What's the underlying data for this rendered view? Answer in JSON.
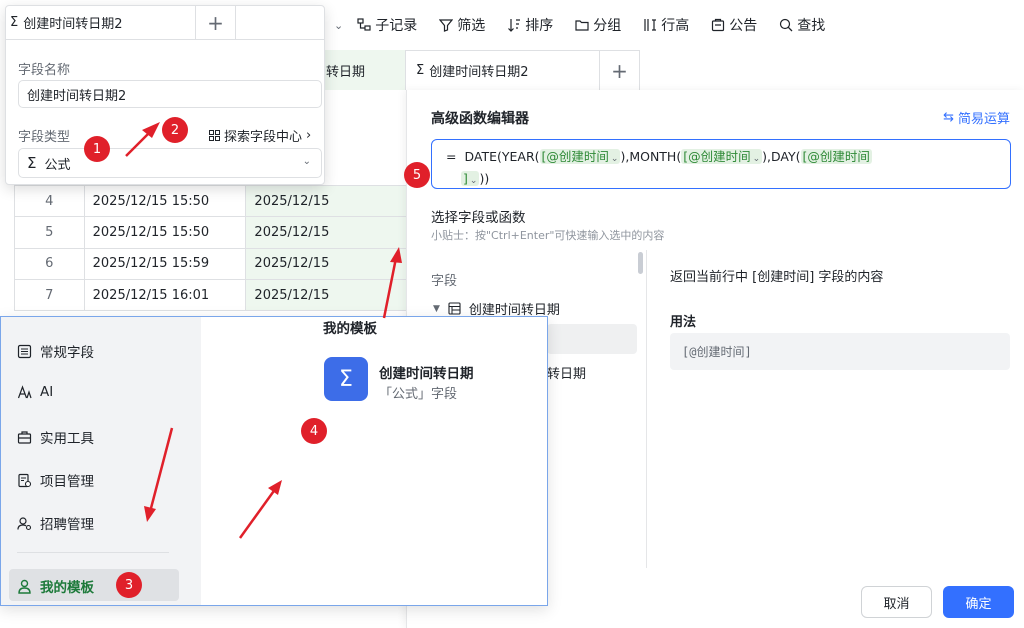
{
  "toolbar": {
    "items": [
      "子记录",
      "筛选",
      "排序",
      "分组",
      "行高",
      "公告",
      "查找"
    ]
  },
  "tabs": {
    "left_partial": "转日期",
    "formula_tab": "创建时间转日期2",
    "add": "+"
  },
  "grid": {
    "rows": [
      {
        "num": "4",
        "created": "2025/12/15 15:50",
        "date": "2025/12/15"
      },
      {
        "num": "5",
        "created": "2025/12/15 15:50",
        "date": "2025/12/15"
      },
      {
        "num": "6",
        "created": "2025/12/15 15:59",
        "date": "2025/12/15"
      },
      {
        "num": "7",
        "created": "2025/12/15 16:01",
        "date": "2025/12/15"
      }
    ]
  },
  "popup": {
    "header_name": "创建时间转日期2",
    "header_plus": "+",
    "field_name_label": "字段名称",
    "field_name_value": "创建时间转日期2",
    "field_type_label": "字段类型",
    "explore_label": "探索字段中心",
    "explore_arrow": "›",
    "type_value": "公式",
    "type_icon": "Σ"
  },
  "editor": {
    "title": "高级函数编辑器",
    "simple_mode": "简易运算",
    "formula": {
      "eq": "=",
      "p1": "DATE(YEAR(",
      "chip1": "[@创建时间",
      "p2": "),MONTH(",
      "chip2": "[@创建时间",
      "p3": "),DAY(",
      "chip3a": "[@创建时间",
      "chip3b": "]",
      "p4": "))"
    },
    "section_title": "选择字段或函数",
    "tip": "小贴士：按\"Ctrl+Enter\"可快速输入选中的内容",
    "fields_label": "字段",
    "tree_item": "创建时间转日期",
    "partial_item": "转日期",
    "description": "返回当前行中 [创建时间] 字段的内容",
    "usage_label": "用法",
    "usage_value": "[@创建时间]",
    "cancel": "取消",
    "ok": "确定"
  },
  "templates": {
    "sidebar": [
      "常规字段",
      "AI",
      "实用工具",
      "项目管理",
      "招聘管理"
    ],
    "active": "我的模板",
    "heading": "我的模板",
    "card_title": "创建时间转日期",
    "card_sub": "「公式」字段",
    "card_icon": "Σ"
  },
  "badges": [
    "1",
    "2",
    "3",
    "4",
    "5"
  ],
  "colors": {
    "accent": "#3370ff",
    "annotation": "#e0202a",
    "chip_bg": "#e3f1e3",
    "chip_text": "#2f8a37",
    "active_template": "#1d7a3a"
  }
}
